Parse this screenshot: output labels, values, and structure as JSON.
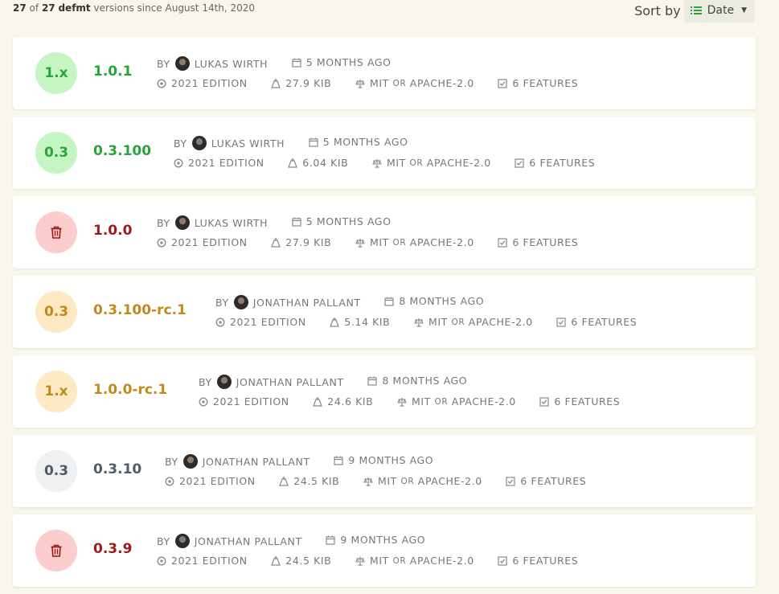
{
  "summary": {
    "shown": "27",
    "of_word": "of",
    "total": "27",
    "crate": "defmt",
    "suffix": "versions since August 14th, 2020"
  },
  "sort": {
    "label": "Sort by",
    "value": "Date"
  },
  "labels": {
    "by": "BY",
    "or": "OR"
  },
  "colors": {
    "green": "#2aa33b",
    "red": "#9d1a1a",
    "amber": "#c18a1c",
    "gray": "#4f5b66",
    "background": "#f9f7ec"
  },
  "versions": [
    {
      "badge": "1.x",
      "version": "1.0.1",
      "status": "green",
      "author": "LUKAS WIRTH",
      "date": "5 MONTHS AGO",
      "edition": "2021 EDITION",
      "size": "27.9 KIB",
      "license_a": "MIT",
      "license_b": "APACHE-2.0",
      "features": "6 FEATURES"
    },
    {
      "badge": "0.3",
      "version": "0.3.100",
      "status": "green",
      "author": "LUKAS WIRTH",
      "date": "5 MONTHS AGO",
      "edition": "2021 EDITION",
      "size": "6.04 KIB",
      "license_a": "MIT",
      "license_b": "APACHE-2.0",
      "features": "6 FEATURES"
    },
    {
      "badge": "trash-icon",
      "version": "1.0.0",
      "status": "red",
      "author": "LUKAS WIRTH",
      "date": "5 MONTHS AGO",
      "edition": "2021 EDITION",
      "size": "27.9 KIB",
      "license_a": "MIT",
      "license_b": "APACHE-2.0",
      "features": "6 FEATURES"
    },
    {
      "badge": "0.3",
      "version": "0.3.100-rc.1",
      "status": "amber",
      "author": "JONATHAN PALLANT",
      "date": "8 MONTHS AGO",
      "edition": "2021 EDITION",
      "size": "5.14 KIB",
      "license_a": "MIT",
      "license_b": "APACHE-2.0",
      "features": "6 FEATURES"
    },
    {
      "badge": "1.x",
      "version": "1.0.0-rc.1",
      "status": "amber",
      "author": "JONATHAN PALLANT",
      "date": "8 MONTHS AGO",
      "edition": "2021 EDITION",
      "size": "24.6 KIB",
      "license_a": "MIT",
      "license_b": "APACHE-2.0",
      "features": "6 FEATURES"
    },
    {
      "badge": "0.3",
      "version": "0.3.10",
      "status": "gray",
      "author": "JONATHAN PALLANT",
      "date": "9 MONTHS AGO",
      "edition": "2021 EDITION",
      "size": "24.5 KIB",
      "license_a": "MIT",
      "license_b": "APACHE-2.0",
      "features": "6 FEATURES"
    },
    {
      "badge": "trash-icon",
      "version": "0.3.9",
      "status": "red",
      "author": "JONATHAN PALLANT",
      "date": "9 MONTHS AGO",
      "edition": "2021 EDITION",
      "size": "24.5 KIB",
      "license_a": "MIT",
      "license_b": "APACHE-2.0",
      "features": "6 FEATURES"
    }
  ]
}
